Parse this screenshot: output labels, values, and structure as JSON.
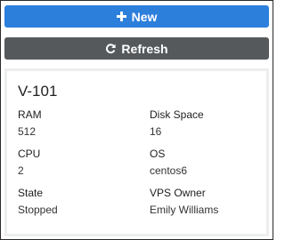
{
  "actions": {
    "new_label": "New",
    "refresh_label": "Refresh"
  },
  "vps": {
    "name": "V-101",
    "ram_label": "RAM",
    "ram_value": "512",
    "disk_label": "Disk Space",
    "disk_value": "16",
    "cpu_label": "CPU",
    "cpu_value": "2",
    "os_label": "OS",
    "os_value": "centos6",
    "state_label": "State",
    "state_value": "Stopped",
    "owner_label": "VPS Owner",
    "owner_value": "Emily Williams"
  },
  "colors": {
    "primary": "#2d7fdc",
    "secondary": "#56595c",
    "panel_bg": "#eceeef"
  },
  "icons": {
    "new": "plus-icon",
    "refresh": "refresh-icon"
  }
}
